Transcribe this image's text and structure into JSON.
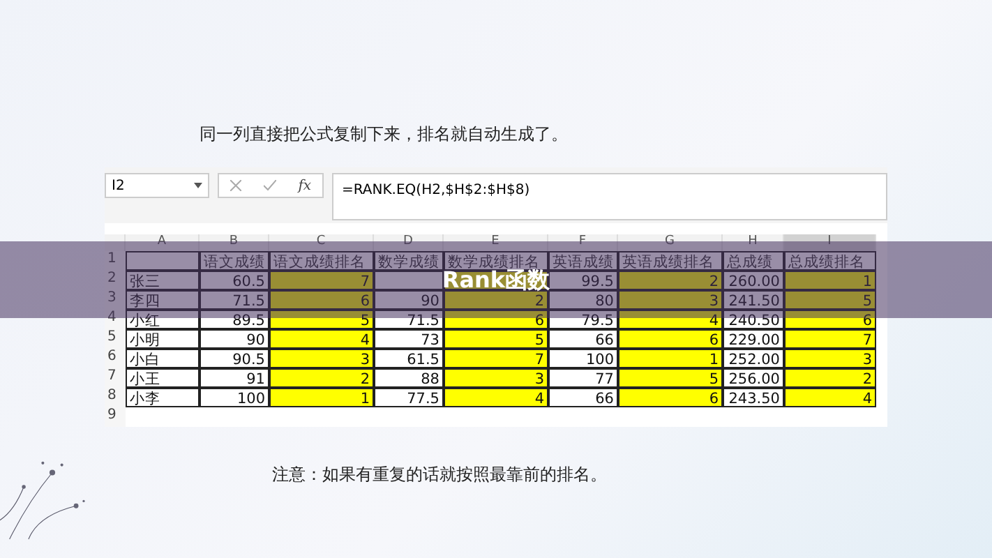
{
  "caption": "同一列直接把公式复制下来，排名就自动生成了。",
  "formula_bar": {
    "name_box": "I2",
    "function_label": "fx",
    "formula": "=RANK.EQ(H2,$H$2:$H$8)"
  },
  "columns": [
    {
      "letter": "A",
      "highlighted": false,
      "selected": false
    },
    {
      "letter": "B",
      "highlighted": false,
      "selected": false
    },
    {
      "letter": "C",
      "highlighted": true,
      "selected": false
    },
    {
      "letter": "D",
      "highlighted": false,
      "selected": false
    },
    {
      "letter": "E",
      "highlighted": true,
      "selected": false
    },
    {
      "letter": "F",
      "highlighted": false,
      "selected": false
    },
    {
      "letter": "G",
      "highlighted": true,
      "selected": false
    },
    {
      "letter": "H",
      "highlighted": false,
      "selected": false
    },
    {
      "letter": "I",
      "highlighted": true,
      "selected": true
    }
  ],
  "rows": [
    {
      "number": "1",
      "kind": "header",
      "cells": [
        "",
        "语文成绩",
        "语文成绩排名",
        "数学成绩",
        "数学成绩排名",
        "英语成绩",
        "英语成绩排名",
        "总成绩",
        "总成绩排名"
      ]
    },
    {
      "number": "2",
      "kind": "data",
      "cells": [
        "张三",
        "60.5",
        "7",
        "",
        "",
        "99.5",
        "2",
        "260.00",
        "1"
      ]
    },
    {
      "number": "3",
      "kind": "data",
      "cells": [
        "李四",
        "71.5",
        "6",
        "90",
        "2",
        "80",
        "3",
        "241.50",
        "5"
      ]
    },
    {
      "number": "4",
      "kind": "data",
      "cells": [
        "小红",
        "89.5",
        "5",
        "71.5",
        "6",
        "79.5",
        "4",
        "240.50",
        "6"
      ]
    },
    {
      "number": "5",
      "kind": "data",
      "cells": [
        "小明",
        "90",
        "4",
        "73",
        "5",
        "66",
        "6",
        "229.00",
        "7"
      ]
    },
    {
      "number": "6",
      "kind": "data",
      "cells": [
        "小白",
        "90.5",
        "3",
        "61.5",
        "7",
        "100",
        "1",
        "252.00",
        "3"
      ]
    },
    {
      "number": "7",
      "kind": "data",
      "cells": [
        "小王",
        "91",
        "2",
        "88",
        "3",
        "77",
        "5",
        "256.00",
        "2"
      ]
    },
    {
      "number": "8",
      "kind": "data",
      "cells": [
        "小李",
        "100",
        "1",
        "77.5",
        "4",
        "66",
        "6",
        "243.50",
        "4"
      ]
    },
    {
      "number": "9",
      "kind": "empty",
      "cells": []
    }
  ],
  "banner": {
    "title": "Rank函数"
  },
  "note": "注意：如果有重复的话就按照最靠前的排名。"
}
